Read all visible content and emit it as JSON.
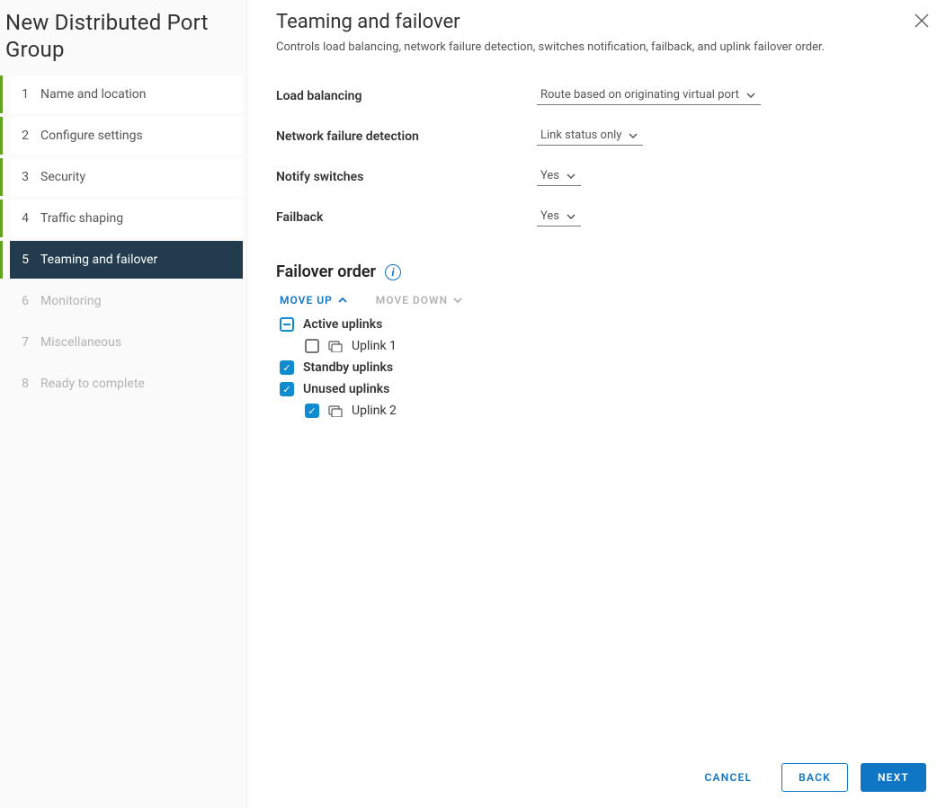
{
  "sidebar": {
    "title": "New Distributed Port Group",
    "steps": [
      {
        "num": "1",
        "label": "Name and location",
        "state": "done"
      },
      {
        "num": "2",
        "label": "Configure settings",
        "state": "done"
      },
      {
        "num": "3",
        "label": "Security",
        "state": "done"
      },
      {
        "num": "4",
        "label": "Traffic shaping",
        "state": "done"
      },
      {
        "num": "5",
        "label": "Teaming and failover",
        "state": "active"
      },
      {
        "num": "6",
        "label": "Monitoring",
        "state": "future"
      },
      {
        "num": "7",
        "label": "Miscellaneous",
        "state": "future"
      },
      {
        "num": "8",
        "label": "Ready to complete",
        "state": "future"
      }
    ]
  },
  "header": {
    "title": "Teaming and failover",
    "description": "Controls load balancing, network failure detection, switches notification, failback, and uplink failover order."
  },
  "form": {
    "load_balancing": {
      "label": "Load balancing",
      "value": "Route based on originating virtual port"
    },
    "network_failure": {
      "label": "Network failure detection",
      "value": "Link status only"
    },
    "notify_switches": {
      "label": "Notify switches",
      "value": "Yes"
    },
    "failback": {
      "label": "Failback",
      "value": "Yes"
    }
  },
  "failover": {
    "title": "Failover order",
    "move_up": "MOVE UP",
    "move_down": "MOVE DOWN",
    "groups": {
      "active": {
        "label": "Active uplinks",
        "items": [
          {
            "name": "Uplink 1",
            "checked": false
          }
        ]
      },
      "standby": {
        "label": "Standby uplinks",
        "checked": true,
        "items": []
      },
      "unused": {
        "label": "Unused uplinks",
        "checked": true,
        "items": [
          {
            "name": "Uplink 2",
            "checked": true
          }
        ]
      }
    }
  },
  "footer": {
    "cancel": "CANCEL",
    "back": "BACK",
    "next": "NEXT"
  }
}
